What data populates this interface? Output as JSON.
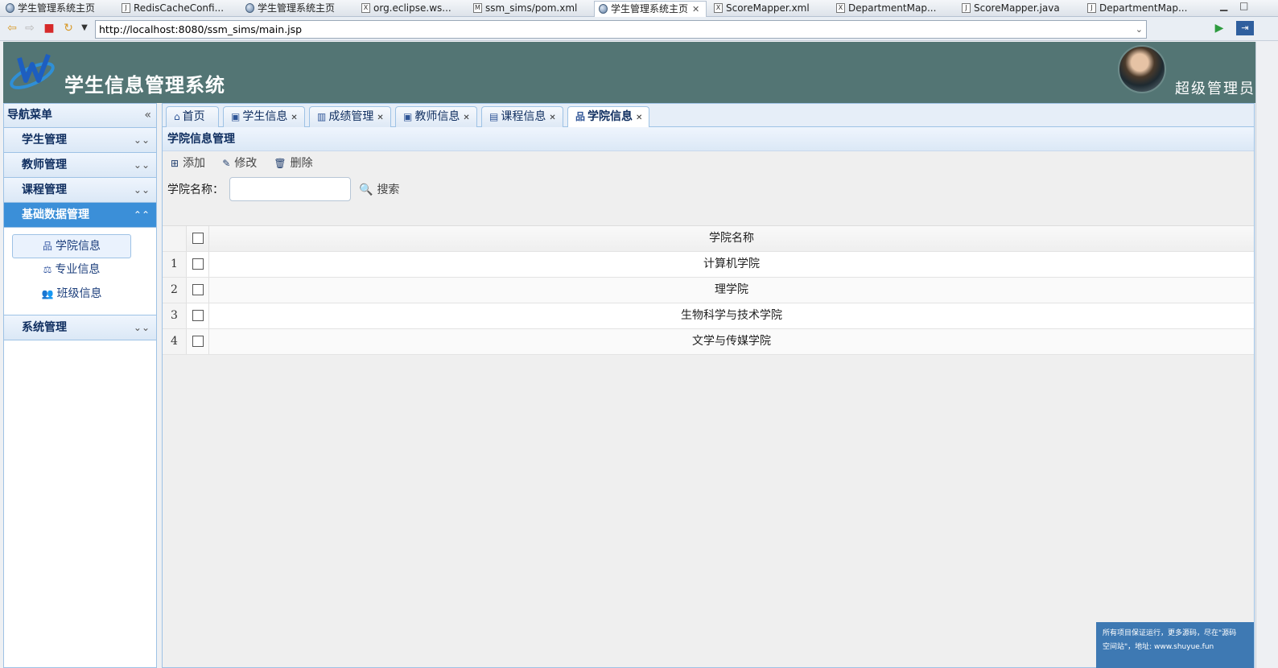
{
  "editor_tabs": [
    {
      "label": "学生管理系统主页",
      "icon": "globe-icon",
      "icon_char": ""
    },
    {
      "label": "RedisCacheConfi...",
      "icon": "java-file-icon",
      "icon_char": "J"
    },
    {
      "label": "学生管理系统主页",
      "icon": "globe-icon",
      "icon_char": ""
    },
    {
      "label": "org.eclipse.ws...",
      "icon": "xml-file-icon",
      "icon_char": "X"
    },
    {
      "label": "ssm_sims/pom.xml",
      "icon": "maven-file-icon",
      "icon_char": "M"
    },
    {
      "label": "学生管理系统主页",
      "icon": "globe-icon",
      "icon_char": "",
      "active": true
    },
    {
      "label": "ScoreMapper.xml",
      "icon": "xml-file-icon",
      "icon_char": "X"
    },
    {
      "label": "DepartmentMap...",
      "icon": "xml-file-icon",
      "icon_char": "X"
    },
    {
      "label": "ScoreMapper.java",
      "icon": "java-file-icon",
      "icon_char": "J"
    },
    {
      "label": "DepartmentMap...",
      "icon": "java-file-icon",
      "icon_char": "J"
    }
  ],
  "browser": {
    "url": "http://localhost:8080/ssm_sims/main.jsp"
  },
  "header": {
    "title": "学生信息管理系统",
    "role": "超级管理员",
    "bg_color": "#537574"
  },
  "sidebar": {
    "title": "导航菜单",
    "accent_color": "#3b8fd8",
    "sections": [
      {
        "label": "学生管理"
      },
      {
        "label": "教师管理"
      },
      {
        "label": "课程管理"
      },
      {
        "label": "基础数据管理",
        "open": true
      },
      {
        "label": "系统管理"
      }
    ],
    "sub_items": [
      {
        "label": "学院信息",
        "icon": "sitemap-icon",
        "selected": true
      },
      {
        "label": "专业信息",
        "icon": "balance-scale-icon"
      },
      {
        "label": "班级信息",
        "icon": "users-icon"
      }
    ]
  },
  "tabs": [
    {
      "label": "首页",
      "icon": "home-icon",
      "closable": false
    },
    {
      "label": "学生信息",
      "icon": "id-card-icon",
      "closable": true
    },
    {
      "label": "成绩管理",
      "icon": "bar-chart-icon",
      "closable": true
    },
    {
      "label": "教师信息",
      "icon": "id-card-icon",
      "closable": true
    },
    {
      "label": "课程信息",
      "icon": "calendar-icon",
      "closable": true
    },
    {
      "label": "学院信息",
      "icon": "sitemap-icon",
      "closable": true,
      "active": true
    }
  ],
  "panel": {
    "title": "学院信息管理",
    "toolbar": {
      "add_label": "添加",
      "edit_label": "修改",
      "delete_label": "删除"
    },
    "search": {
      "label": "学院名称：",
      "value": "",
      "button_label": "搜索"
    },
    "table": {
      "column_header": "学院名称",
      "rows": [
        {
          "index": "1",
          "name": "计算机学院"
        },
        {
          "index": "2",
          "name": "理学院"
        },
        {
          "index": "3",
          "name": "生物科学与技术学院"
        },
        {
          "index": "4",
          "name": "文学与传媒学院"
        }
      ]
    }
  },
  "notice": {
    "line1": "所有项目保证运行，更多源码，尽在\"源码",
    "line2": "空间站\"，地址: www.shuyue.fun"
  }
}
